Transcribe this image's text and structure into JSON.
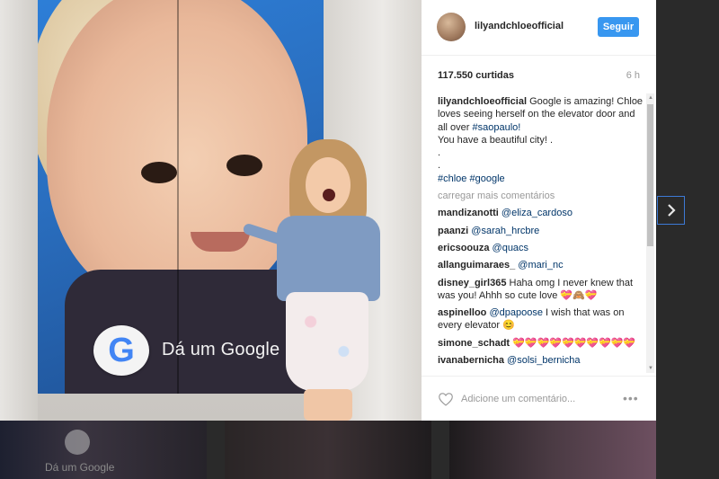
{
  "post": {
    "username": "lilyandchloeofficial",
    "follow_label": "Seguir",
    "likes": "117.550 curtidas",
    "time": "6 h",
    "caption": {
      "text": "Google is amazing! Chloe loves seeing herself on the elevator door and all over",
      "hashtag1": "#saopaulo!",
      "text2": "You have a beautiful city! .",
      "dot1": ".",
      "dot2": ".",
      "hashtag2": "#chloe",
      "hashtag3": "#google"
    },
    "load_more": "carregar mais comentários",
    "comments": [
      {
        "user": "mandizanotti",
        "mention": "@eliza_cardoso",
        "text": ""
      },
      {
        "user": "paanzi",
        "mention": "@sarah_hrcbre",
        "text": ""
      },
      {
        "user": "ericsoouza",
        "mention": "@quacs",
        "text": ""
      },
      {
        "user": "allanguimaraes_",
        "mention": "@mari_nc",
        "text": ""
      },
      {
        "user": "disney_girl365",
        "mention": "",
        "text": "Haha omg I never knew that was you! Ahhh so cute love 💝🙈💝"
      },
      {
        "user": "aspinelloo",
        "mention": "@dpapoose",
        "text": "I wish that was on every elevator 😊"
      },
      {
        "user": "simone_schadt",
        "mention": "",
        "text": "💝💝💝💝💝💝💝💝💝💝"
      },
      {
        "user": "ivanabernicha",
        "mention": "@solsi_bernicha",
        "text": ""
      }
    ],
    "comment_placeholder": "Adicione um comentário..."
  },
  "photo": {
    "overlay_text": "Dá um Google",
    "badge_letter": "G"
  },
  "backdrop": {
    "thumb_text": "Dá um Google"
  },
  "colors": {
    "follow": "#3897f0",
    "link": "#003569",
    "next_border": "#3d7ad6"
  }
}
